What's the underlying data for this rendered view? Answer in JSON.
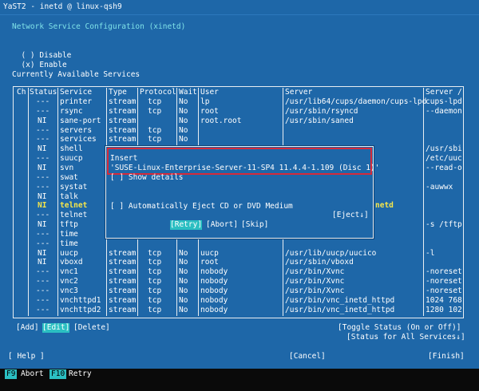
{
  "window_title": "YaST2 - inetd @ linux-qsh9",
  "heading": "Network Service Configuration (xinetd)",
  "options": [
    {
      "mark": "( )",
      "label": "Disable"
    },
    {
      "mark": "(x)",
      "label": "Enable"
    }
  ],
  "table_label": "Currently Available Services",
  "columns": [
    "Ch",
    "Status",
    "Service",
    "Type",
    "Protocol",
    "Wait",
    "User",
    "Server",
    "Server /"
  ],
  "rows": [
    {
      "status": "---",
      "service": "printer",
      "type": "stream",
      "protocol": "tcp",
      "wait": "No",
      "user": "lp",
      "server": "/usr/lib64/cups/daemon/cups-lpd",
      "args": "cups-lpd"
    },
    {
      "status": "---",
      "service": "rsync",
      "type": "stream",
      "protocol": "tcp",
      "wait": "No",
      "user": "root",
      "server": "/usr/sbin/rsyncd",
      "args": "--daemon"
    },
    {
      "status": "NI",
      "service": "sane-port",
      "type": "stream",
      "protocol": "",
      "wait": "No",
      "user": "root.root",
      "server": "/usr/sbin/saned",
      "args": ""
    },
    {
      "status": "---",
      "service": "servers",
      "type": "stream",
      "protocol": "tcp",
      "wait": "No",
      "user": "",
      "server": "",
      "args": ""
    },
    {
      "status": "---",
      "service": "services",
      "type": "stream",
      "protocol": "tcp",
      "wait": "No",
      "user": "",
      "server": "",
      "args": ""
    },
    {
      "status": "NI",
      "service": "shell",
      "type": "",
      "protocol": "",
      "wait": "",
      "user": "",
      "server": "",
      "args": "/usr/sbi"
    },
    {
      "status": "---",
      "service": "suucp",
      "type": "",
      "protocol": "",
      "wait": "",
      "user": "",
      "server": "",
      "args": "/etc/uuc"
    },
    {
      "status": "NI",
      "service": "svn",
      "type": "",
      "protocol": "",
      "wait": "",
      "user": "",
      "server": "",
      "args": "--read-o"
    },
    {
      "status": "---",
      "service": "swat",
      "type": "",
      "protocol": "",
      "wait": "",
      "user": "",
      "server": "",
      "args": ""
    },
    {
      "status": "---",
      "service": "systat",
      "type": "",
      "protocol": "",
      "wait": "",
      "user": "",
      "server": "",
      "args": "-auwwx"
    },
    {
      "status": "NI",
      "service": "talk",
      "type": "",
      "protocol": "",
      "wait": "",
      "user": "",
      "server": "",
      "args": ""
    },
    {
      "status": "NI",
      "service": "telnet",
      "type": "",
      "protocol": "",
      "wait": "",
      "user": "",
      "server": "netd",
      "args": ""
    },
    {
      "status": "---",
      "service": "telnet",
      "type": "",
      "protocol": "",
      "wait": "",
      "user": "",
      "server": "",
      "args": ""
    },
    {
      "status": "NI",
      "service": "tftp",
      "type": "",
      "protocol": "",
      "wait": "",
      "user": "",
      "server": "",
      "args": "-s /tftp"
    },
    {
      "status": "---",
      "service": "time",
      "type": "",
      "protocol": "",
      "wait": "",
      "user": "",
      "server": "",
      "args": ""
    },
    {
      "status": "---",
      "service": "time",
      "type": "",
      "protocol": "",
      "wait": "",
      "user": "",
      "server": "",
      "args": ""
    },
    {
      "status": "NI",
      "service": "uucp",
      "type": "stream",
      "protocol": "tcp",
      "wait": "No",
      "user": "uucp",
      "server": "/usr/lib/uucp/uucico",
      "args": "-l"
    },
    {
      "status": "NI",
      "service": "vboxd",
      "type": "stream",
      "protocol": "tcp",
      "wait": "No",
      "user": "root",
      "server": "/usr/sbin/vboxd",
      "args": ""
    },
    {
      "status": "---",
      "service": "vnc1",
      "type": "stream",
      "protocol": "tcp",
      "wait": "No",
      "user": "nobody",
      "server": "/usr/bin/Xvnc",
      "args": "-noreset"
    },
    {
      "status": "---",
      "service": "vnc2",
      "type": "stream",
      "protocol": "tcp",
      "wait": "No",
      "user": "nobody",
      "server": "/usr/bin/Xvnc",
      "args": "-noreset"
    },
    {
      "status": "---",
      "service": "vnc3",
      "type": "stream",
      "protocol": "tcp",
      "wait": "No",
      "user": "nobody",
      "server": "/usr/bin/Xvnc",
      "args": "-noreset"
    },
    {
      "status": "---",
      "service": "vnchttpd1",
      "type": "stream",
      "protocol": "tcp",
      "wait": "No",
      "user": "nobody",
      "server": "/usr/bin/vnc_inetd_httpd",
      "args": "1024 768"
    },
    {
      "status": "---",
      "service": "vnchttpd2",
      "type": "stream",
      "protocol": "tcp",
      "wait": "No",
      "user": "nobody",
      "server": "/usr/bin/vnc_inetd_httpd",
      "args": "1280 102"
    }
  ],
  "table_buttons": {
    "add": "[Add]",
    "edit": "[Edit]",
    "delete": "[Delete]",
    "toggle": "[Toggle Status (On or Off)]",
    "status_all": "[Status for All Services↓]"
  },
  "bottom_buttons": {
    "help": "[ Help ]",
    "cancel": "[Cancel]",
    "finish": "[Finish]"
  },
  "dialog": {
    "insert_label": "Insert",
    "media_name": "'SUSE-Linux-Enterprise-Server-11-SP4 11.4.4-1.109 (Disc 1)'",
    "show_details": "[ ] Show details",
    "auto_eject": "[ ] Automatically Eject CD or DVD Medium",
    "eject": "[Eject↓]",
    "retry": "[Retry]",
    "abort": "[Abort]",
    "skip": "[Skip]"
  },
  "fkeys": [
    {
      "key": "F9",
      "label": "Abort"
    },
    {
      "key": "F10",
      "label": "Retry"
    }
  ],
  "colors": {
    "background": "#1e67a8",
    "cyan_text": "#7fe2e8",
    "highlight": "#f6e64a",
    "focus": "#2bbfc2",
    "red_outline": "#d62a3a"
  }
}
